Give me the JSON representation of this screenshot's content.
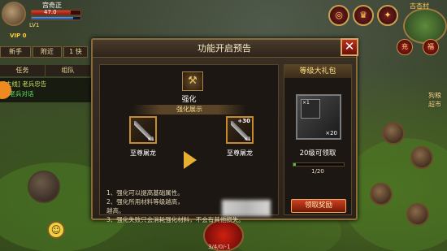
{
  "player": {
    "name": "宫奇正",
    "hp": "47.0",
    "level": "LV1",
    "vip": "VIP 0"
  },
  "left_buttons": [
    "新手",
    "附近",
    "1 快"
  ],
  "tabs": [
    "任务",
    "组队"
  ],
  "quest": {
    "title": "[主线] 老兵忠告",
    "line2": "与老兵对话"
  },
  "right": {
    "town": "古杏村",
    "side_label_lines": [
      "狗粮",
      "超市"
    ],
    "red_buttons": [
      "充",
      "福"
    ]
  },
  "dialog": {
    "title": "功能开启预告",
    "close": "✕",
    "feature": {
      "icon": "hammer-icon",
      "name": "强化"
    },
    "section_title": "强化展示",
    "before_item": {
      "name": "至尊屠龙",
      "qty": "×1"
    },
    "after_item": {
      "name": "至尊屠龙",
      "qty": "×1",
      "plus": "+30"
    },
    "rules": [
      "1、强化可以提高基础属性。",
      "2、强化所用材料等级越高，",
      "越高。",
      "3、强化失败只会消耗强化材料，不会有其他损失。"
    ],
    "gift": {
      "title": "等级大礼包",
      "sub_qty": "×1",
      "qty": "×20",
      "condition": "20级可领取",
      "progress": "1/20",
      "progress_fraction": 0.05,
      "claim": "领取奖励"
    }
  },
  "chat_text": "3/4/0/-1"
}
